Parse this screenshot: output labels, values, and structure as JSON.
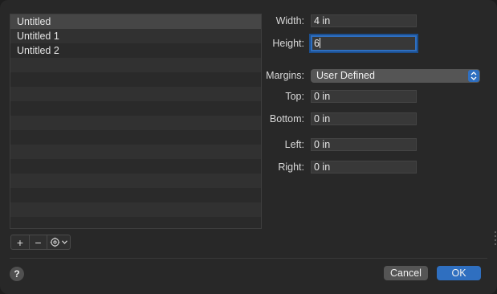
{
  "list": {
    "items": [
      {
        "label": "Untitled",
        "selected": true
      },
      {
        "label": "Untitled 1",
        "selected": false
      },
      {
        "label": "Untitled 2",
        "selected": false
      }
    ]
  },
  "list_buttons": {
    "add": "+",
    "remove": "−",
    "more": "⚙"
  },
  "form": {
    "width_label": "Width:",
    "width_value": "4 in",
    "height_label": "Height:",
    "height_value": "6",
    "margins_label": "Margins:",
    "margins_value": "User Defined",
    "top_label": "Top:",
    "top_value": "0 in",
    "bottom_label": "Bottom:",
    "bottom_value": "0 in",
    "left_label": "Left:",
    "left_value": "0 in",
    "right_label": "Right:",
    "right_value": "0 in"
  },
  "footer": {
    "help": "?",
    "cancel": "Cancel",
    "ok": "OK"
  },
  "colors": {
    "accent": "#2f6fc0",
    "background": "#282828"
  }
}
